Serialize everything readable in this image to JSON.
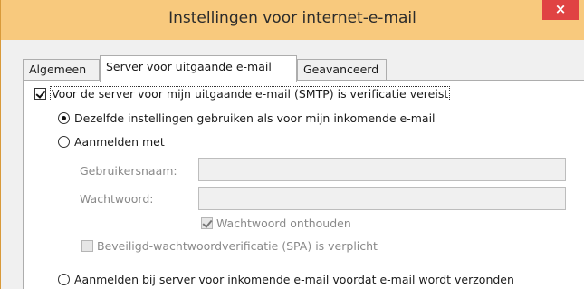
{
  "window": {
    "title": "Instellingen voor internet-e-mail",
    "close_glyph": "×",
    "accent_color": "#f8c97d",
    "close_color": "#e04343"
  },
  "tabs": [
    {
      "label": "Algemeen",
      "active": false
    },
    {
      "label": "Server voor uitgaande e-mail",
      "active": true
    },
    {
      "label": "Geavanceerd",
      "active": false
    }
  ],
  "smtp_auth": {
    "label": "Voor de server voor mijn uitgaande e-mail (SMTP) is verificatie vereist",
    "checked": true
  },
  "options": {
    "same_settings": {
      "label": "Dezelfde instellingen gebruiken als voor mijn inkomende e-mail",
      "selected": true
    },
    "login_with": {
      "label": "Aanmelden met",
      "selected": false
    },
    "login_incoming_first": {
      "label": "Aanmelden bij server voor inkomende e-mail voordat e-mail wordt verzonden",
      "selected": false
    }
  },
  "fields": {
    "username_label": "Gebruikersnaam:",
    "username_value": "",
    "password_label": "Wachtwoord:",
    "password_value": ""
  },
  "remember_password": {
    "label": "Wachtwoord onthouden",
    "checked": true,
    "enabled": false
  },
  "spa": {
    "label": "Beveiligd-wachtwoordverificatie (SPA) is verplicht",
    "checked": false,
    "enabled": false
  }
}
